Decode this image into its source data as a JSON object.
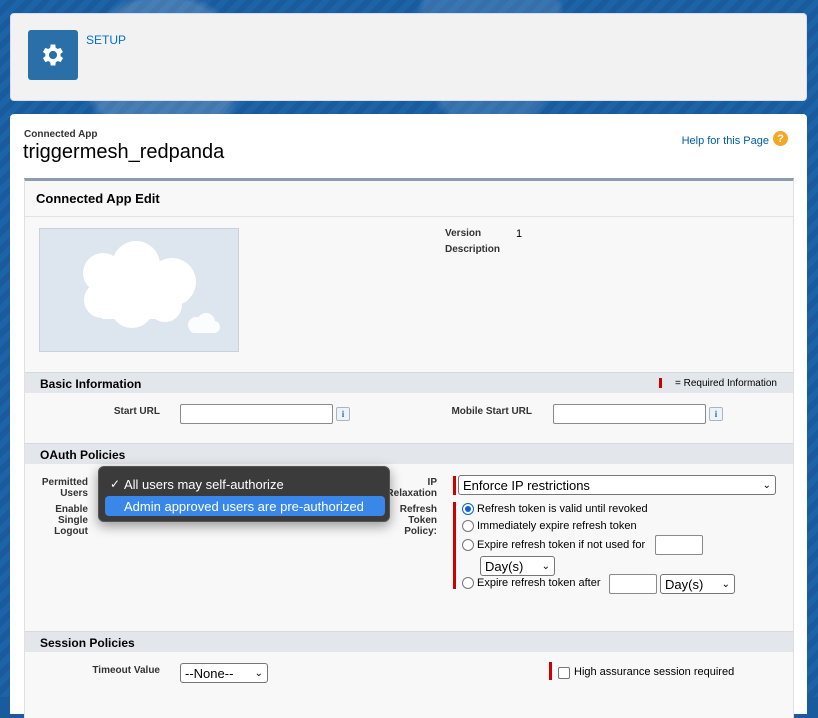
{
  "header": {
    "label": "SETUP"
  },
  "app": {
    "kicker": "Connected App",
    "title": "triggermesh_redpanda",
    "help_link": "Help for this Page",
    "help_icon": "question-icon"
  },
  "panel": {
    "title": "Connected App Edit",
    "version_label": "Version",
    "version_value": "1",
    "description_label": "Description"
  },
  "basic_info": {
    "title": "Basic Information",
    "required_text": "= Required Information",
    "start_url_label": "Start URL",
    "mobile_start_url_label": "Mobile Start URL"
  },
  "oauth": {
    "title": "OAuth Policies",
    "permitted_users_label_1": "Permitted",
    "permitted_users_label_2": "Users",
    "single_logout_label_1": "Enable",
    "single_logout_label_2": "Single",
    "single_logout_label_3": "Logout",
    "ip_label_1": "IP",
    "ip_label_2": "Relaxation",
    "ip_value": "Enforce IP restrictions",
    "refresh_label_1": "Refresh",
    "refresh_label_2": "Token",
    "refresh_label_3": "Policy:",
    "refresh_options": [
      "Refresh token is valid until revoked",
      "Immediately expire refresh token",
      "Expire refresh token if not used for",
      "Expire refresh token after"
    ],
    "unit_value": "Day(s)",
    "permitted_options": [
      "All users may self-authorize",
      "Admin approved users are pre-authorized"
    ]
  },
  "session": {
    "title": "Session Policies",
    "timeout_label": "Timeout Value",
    "timeout_value": "--None--",
    "high_assurance_label": "High assurance session required"
  }
}
